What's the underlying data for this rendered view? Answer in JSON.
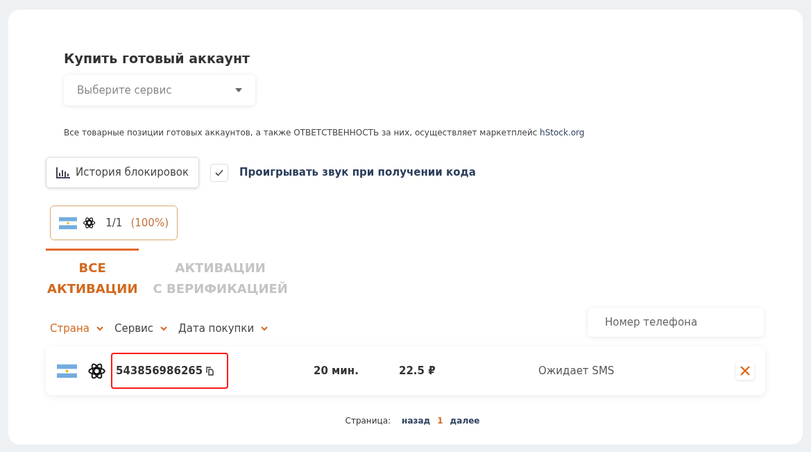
{
  "title": "Купить готовый аккаунт",
  "service_select": {
    "placeholder": "Выберите сервис"
  },
  "notice": {
    "text": "Все товарные позиции готовых аккаунтов, а также ОТВЕТСТВЕННОСТЬ за них, осуществляет маркетплейс ",
    "link": "hStock.org"
  },
  "history_button": "История блокировок",
  "sound_option": {
    "label": "Проигрывать звук при получении кода",
    "checked": true
  },
  "summary_chip": {
    "count": "1/1",
    "percent": "(100%)"
  },
  "tabs": [
    {
      "lines": [
        "ВСЕ",
        "АКТИВАЦИИ"
      ],
      "selected": true
    },
    {
      "lines": [
        "АКТИВАЦИИ",
        "С ВЕРИФИКАЦИЕЙ"
      ],
      "selected": false
    }
  ],
  "sort_options": [
    {
      "label": "Страна",
      "selected": true
    },
    {
      "label": "Сервис",
      "selected": false
    },
    {
      "label": "Дата покупки",
      "selected": false
    }
  ],
  "phone_filter": {
    "placeholder": "Номер телефона"
  },
  "rows": [
    {
      "number": "543856986265",
      "time": "20 мин.",
      "price": "22.5 ₽",
      "status": "Ожидает SMS",
      "highlighted": true
    }
  ],
  "pagination": {
    "label": "Страница:",
    "prev": "назад",
    "page": "1",
    "next": "далее"
  }
}
